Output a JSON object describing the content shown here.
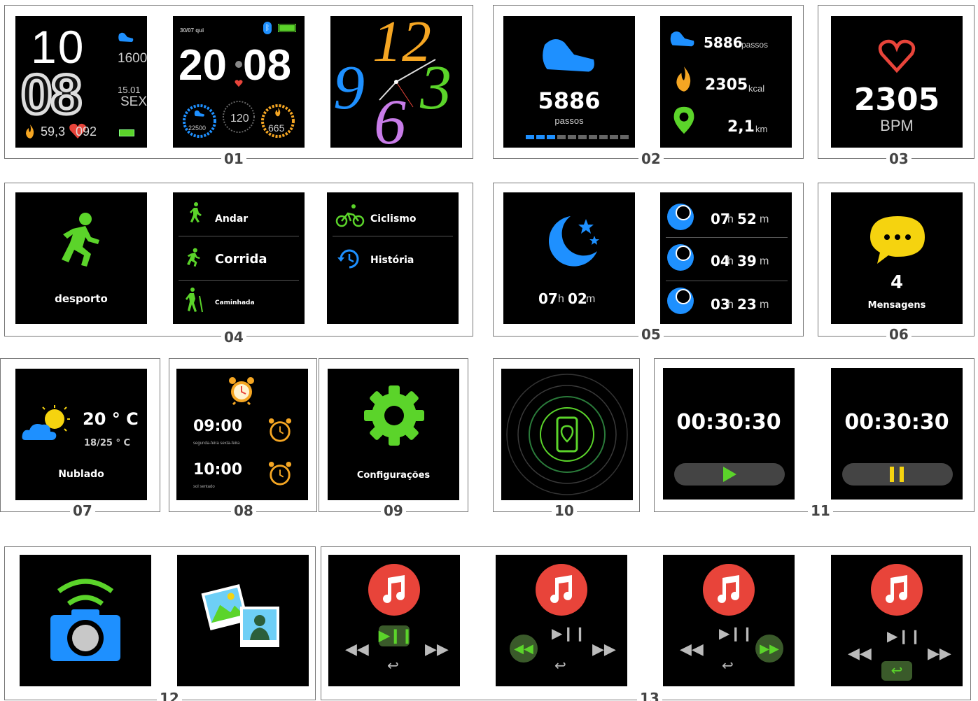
{
  "sections": {
    "s01": "01",
    "s02": "02",
    "s03": "03",
    "s04": "04",
    "s05": "05",
    "s06": "06",
    "s07": "07",
    "s08": "08",
    "s09": "09",
    "s10": "10",
    "s11": "11",
    "s12": "12",
    "s13": "13"
  },
  "watchface1": {
    "hour": "10",
    "minute": "08",
    "steps": "1600",
    "date": "15.01",
    "weekday": "SEX",
    "calories": "59,3",
    "heart": "092"
  },
  "watchface2": {
    "date": "30/07 qui",
    "time_hh": "20",
    "time_mm": "08",
    "steps_goal": "22500",
    "heart": "120",
    "kcal": "665"
  },
  "watchface3": {
    "numbers": [
      "12",
      "3",
      "6",
      "9"
    ]
  },
  "steps": {
    "count": "5886",
    "unit": "passos",
    "progress": 0.3
  },
  "summary": {
    "steps": "5886",
    "steps_unit": "passos",
    "kcal": "2305",
    "kcal_unit": "kcal",
    "distance": "2,1",
    "distance_unit": "km"
  },
  "heart": {
    "value": "2305",
    "unit": "BPM"
  },
  "sport": {
    "label": "desporto",
    "items": [
      "Andar",
      "Corrida",
      "Caminhada",
      "Ciclismo",
      "História"
    ]
  },
  "sleep": {
    "h": "07",
    "hu": "h",
    "m": "02",
    "mu": "m",
    "rows": [
      {
        "h": "07",
        "m": "52"
      },
      {
        "h": "04",
        "m": "39"
      },
      {
        "h": "03",
        "m": "23"
      }
    ],
    "mu2": "m"
  },
  "messages": {
    "count": "4",
    "label": "Mensagens"
  },
  "weather": {
    "temp": "20 ° C",
    "range": "18/25 ° C",
    "condition": "Nublado"
  },
  "alarms": [
    {
      "time": "09:00",
      "days": "segunda-feira sexta-feira"
    },
    {
      "time": "10:00",
      "days": "sol sentado"
    }
  ],
  "settings": {
    "label": "Configurações"
  },
  "stopwatch": {
    "time1": "00:30:30",
    "time2": "00:30:30"
  },
  "colors": {
    "green": "#5bd42a",
    "blue": "#1e90ff",
    "orange": "#f5a623",
    "red": "#e8443a",
    "yellow": "#f5d30f"
  }
}
